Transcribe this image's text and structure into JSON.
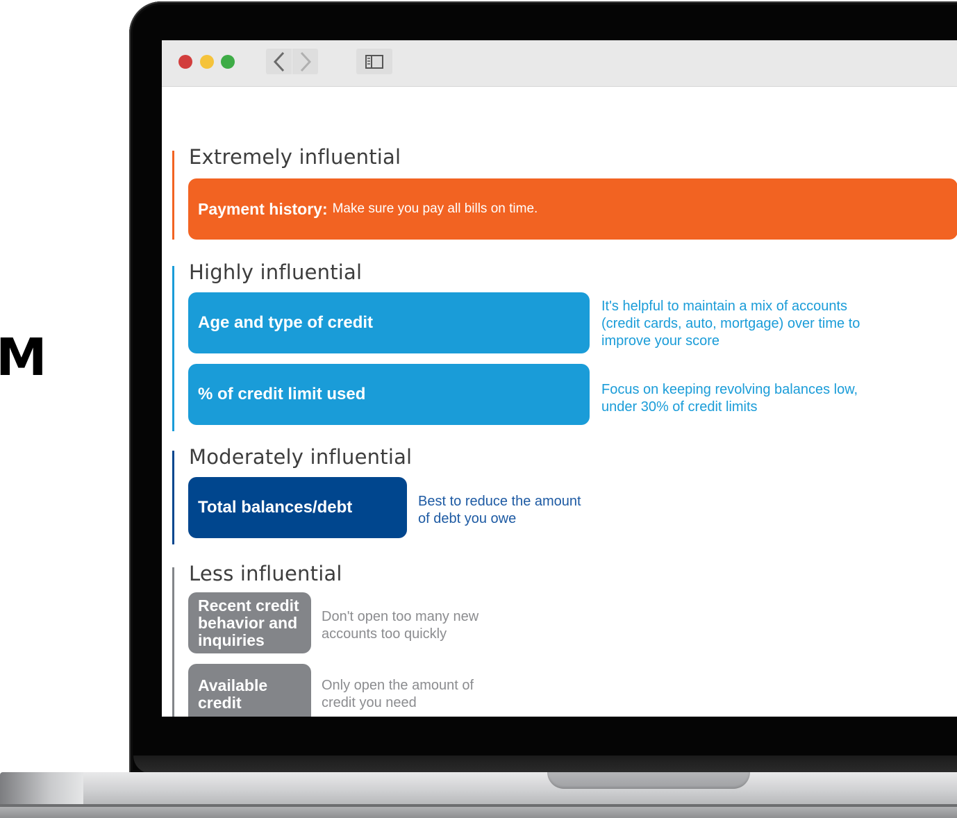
{
  "side_text": "M",
  "browser": {
    "controls": [
      "close-dot",
      "minimize-dot",
      "zoom-dot"
    ],
    "back_icon": "chevron-left-icon",
    "forward_icon": "chevron-right-icon",
    "sidebar_icon": "sidebar-toggle-icon"
  },
  "colors": {
    "extreme": "#f26322",
    "high": "#1a9cd8",
    "moderate": "#00468e",
    "less": "#838589",
    "extreme_text": "#f26322",
    "high_text": "#1a9cd8",
    "moderate_text": "#1d5aa3",
    "less_text": "#8b8c8f"
  },
  "sections": {
    "extreme": {
      "title": "Extremely influential",
      "box_label": "Payment history:",
      "box_text": "Make sure you pay all bills on time."
    },
    "high": {
      "title": "Highly influential",
      "items": [
        {
          "label": "Age and type of credit",
          "desc": "It's helpful to maintain a mix of accounts\n(credit cards, auto, mortgage) over time to\nimprove your score"
        },
        {
          "label": "% of credit limit used",
          "desc": "Focus on keeping revolving balances low,\nunder 30% of credit limits"
        }
      ]
    },
    "moderate": {
      "title": "Moderately influential",
      "items": [
        {
          "label": "Total balances/debt",
          "desc": "Best to reduce the amount\nof debt you owe"
        }
      ]
    },
    "less": {
      "title": "Less influential",
      "items": [
        {
          "label": "Recent credit\nbehavior and\ninquiries",
          "desc": "Don't open too many new\naccounts too quickly"
        },
        {
          "label": "Available\ncredit",
          "desc": "Only open the amount of\ncredit you need"
        }
      ]
    }
  }
}
